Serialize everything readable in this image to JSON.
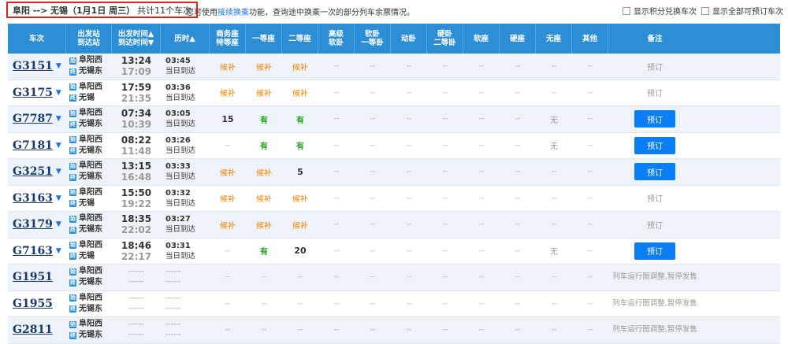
{
  "header": {
    "route": "阜阳 --> 无锡（1月1日 周三）",
    "count": "共计11个车次",
    "notice_pre": "您可使用",
    "notice_link": "接续换乘",
    "notice_post": "功能，查询途中换乘一次的部分列车余票情况。",
    "option1": "显示积分兑换车次",
    "option2": "显示全部可预订车次"
  },
  "columns": [
    "车次",
    "出发站",
    "到达站",
    "出发时间▲",
    "到达时间▼",
    "历时▲",
    "商务座",
    "特等座",
    "一等座",
    "二等座",
    "高级",
    "软卧",
    "软卧",
    "一等卧",
    "动卧",
    "硬卧",
    "二等卧",
    "软座",
    "硬座",
    "无座",
    "其他",
    "备注"
  ],
  "rows": [
    {
      "train": "G3151",
      "from": "阜阳西",
      "to": "无锡东",
      "dep": "13:24",
      "arr": "17:09",
      "dur": "03:45",
      "note": "当日到达",
      "biz": "候补",
      "first": "候补",
      "second": "候补",
      "nostand": "--",
      "action": "预订",
      "action_type": "text"
    },
    {
      "train": "G3175",
      "from": "阜阳西",
      "to": "无锡",
      "dep": "17:59",
      "arr": "21:35",
      "dur": "03:36",
      "note": "当日到达",
      "biz": "候补",
      "first": "候补",
      "second": "候补",
      "nostand": "--",
      "action": "预订",
      "action_type": "text"
    },
    {
      "train": "G7787",
      "from": "阜阳西",
      "to": "无锡东",
      "dep": "07:34",
      "arr": "10:39",
      "dur": "03:05",
      "note": "当日到达",
      "biz": "15",
      "first": "有",
      "second": "有",
      "nostand": "无",
      "action": "预订",
      "action_type": "button"
    },
    {
      "train": "G7181",
      "from": "阜阳西",
      "to": "无锡东",
      "dep": "08:22",
      "arr": "11:48",
      "dur": "03:26",
      "note": "当日到达",
      "biz": "--",
      "first": "有",
      "second": "有",
      "nostand": "无",
      "action": "预订",
      "action_type": "button"
    },
    {
      "train": "G3251",
      "from": "阜阳西",
      "to": "无锡东",
      "dep": "13:15",
      "arr": "16:48",
      "dur": "03:33",
      "note": "当日到达",
      "biz": "候补",
      "first": "候补",
      "second": "5",
      "nostand": "--",
      "action": "预订",
      "action_type": "button"
    },
    {
      "train": "G3163",
      "from": "阜阳西",
      "to": "无锡",
      "dep": "15:50",
      "arr": "19:22",
      "dur": "03:32",
      "note": "当日到达",
      "biz": "候补",
      "first": "候补",
      "second": "候补",
      "nostand": "--",
      "action": "预订",
      "action_type": "text"
    },
    {
      "train": "G3179",
      "from": "阜阳西",
      "to": "无锡东",
      "dep": "18:35",
      "arr": "22:02",
      "dur": "03:27",
      "note": "当日到达",
      "biz": "候补",
      "first": "候补",
      "second": "候补",
      "nostand": "--",
      "action": "预订",
      "action_type": "text"
    },
    {
      "train": "G7163",
      "from": "阜阳西",
      "to": "无锡",
      "dep": "18:46",
      "arr": "22:17",
      "dur": "03:31",
      "note": "当日到达",
      "biz": "--",
      "first": "有",
      "second": "20",
      "nostand": "无",
      "action": "预订",
      "action_type": "button"
    },
    {
      "train": "G1951",
      "from": "阜阳西",
      "to": "无锡东",
      "dep": "------",
      "arr": "------",
      "dur": "------",
      "note": "------",
      "biz": "--",
      "first": "--",
      "second": "--",
      "nostand": "--",
      "action": "列车运行图调整,暂停发售",
      "action_type": "remark"
    },
    {
      "train": "G1955",
      "from": "阜阳西",
      "to": "无锡东",
      "dep": "------",
      "arr": "------",
      "dur": "------",
      "note": "------",
      "biz": "--",
      "first": "--",
      "second": "--",
      "nostand": "--",
      "action": "列车运行图调整,暂停发售",
      "action_type": "remark"
    },
    {
      "train": "G2811",
      "from": "阜阳西",
      "to": "无锡东",
      "dep": "------",
      "arr": "------",
      "dur": "------",
      "note": "------",
      "biz": "--",
      "first": "--",
      "second": "--",
      "nostand": "--",
      "action": "列车运行图调整,暂停发售",
      "action_type": "remark"
    }
  ],
  "empty_value": "--",
  "station_icon_from": "始",
  "station_icon_to": "终",
  "dropdown_icon": "chevron-down-icon",
  "colors": {
    "header_bg": "#2c8fd6",
    "book_button": "#0a7ff5",
    "waitlist": "#f08300",
    "available": "#22a322",
    "highlight_border": "#d9261c"
  }
}
